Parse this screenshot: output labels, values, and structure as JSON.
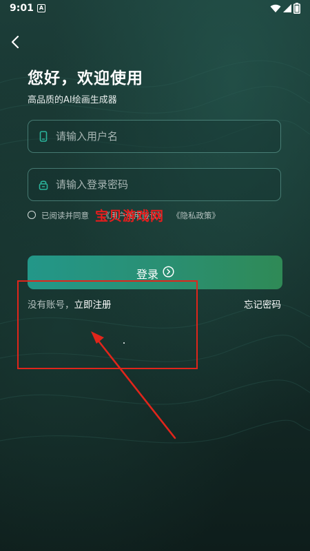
{
  "status_bar": {
    "time": "9:01",
    "app_icon": "A",
    "icons": [
      "wifi-icon",
      "signal-icon",
      "battery-icon"
    ]
  },
  "header": {
    "back_icon": "chevron-left-icon",
    "title": "您好，欢迎使用",
    "subtitle": "高品质的AI绘画生成器"
  },
  "form": {
    "username": {
      "placeholder": "请输入用户名",
      "value": "",
      "icon": "phone-icon"
    },
    "password": {
      "placeholder": "请输入登录密码",
      "value": "",
      "icon": "lock-icon"
    },
    "agreement": {
      "checked": false,
      "prefix": "已阅读并同意",
      "user_agreement": "《用户使用协议》",
      "privacy_policy": "《隐私政策》"
    },
    "login_label": "登录",
    "login_icon": "arrow-circle-icon",
    "no_account": "没有账号，",
    "register_label": "立即注册",
    "forgot_label": "忘记密码"
  },
  "overlay": {
    "watermark": "宝贝游戏网",
    "annotation_color": "#e0251b"
  },
  "colors": {
    "background_top": "#1c3e39",
    "background_bottom": "#0e1d1b",
    "button_start": "#239789",
    "button_end": "#2f8a56"
  }
}
